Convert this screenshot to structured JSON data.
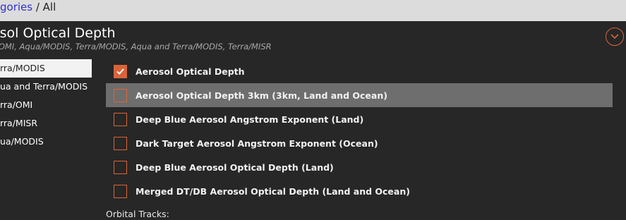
{
  "breadcrumb": {
    "link_text": "gories",
    "separator": " / ",
    "current": "All"
  },
  "header": {
    "title": "osol Optical Depth",
    "subtitle": "/OMI, Aqua/MODIS, Terra/MODIS, Aqua and Terra/MODIS, Terra/MISR",
    "collapse_icon": "chevron-down-circle-icon"
  },
  "sidebar": {
    "items": [
      {
        "label": "rra/MODIS",
        "active": true
      },
      {
        "label": "ua and Terra/MODIS",
        "active": false
      },
      {
        "label": "rra/OMI",
        "active": false
      },
      {
        "label": "rra/MISR",
        "active": false
      },
      {
        "label": "ua/MODIS",
        "active": false
      }
    ]
  },
  "layers": [
    {
      "label": "Aerosol Optical Depth",
      "checked": true
    },
    {
      "label": "Aerosol Optical Depth 3km (3km, Land and Ocean)",
      "checked": false
    },
    {
      "label": "Deep Blue Aerosol Angstrom Exponent (Land)",
      "checked": false
    },
    {
      "label": "Dark Target Aerosol Angstrom Exponent (Ocean)",
      "checked": false
    },
    {
      "label": "Deep Blue Aerosol Optical Depth (Land)",
      "checked": false
    },
    {
      "label": "Merged DT/DB Aerosol Optical Depth (Land and Ocean)",
      "checked": false
    }
  ],
  "orbital_tracks_label": "Orbital Tracks:",
  "colors": {
    "accent": "#d9643a",
    "background": "#272727",
    "hover_row": "#6e6e6e"
  }
}
